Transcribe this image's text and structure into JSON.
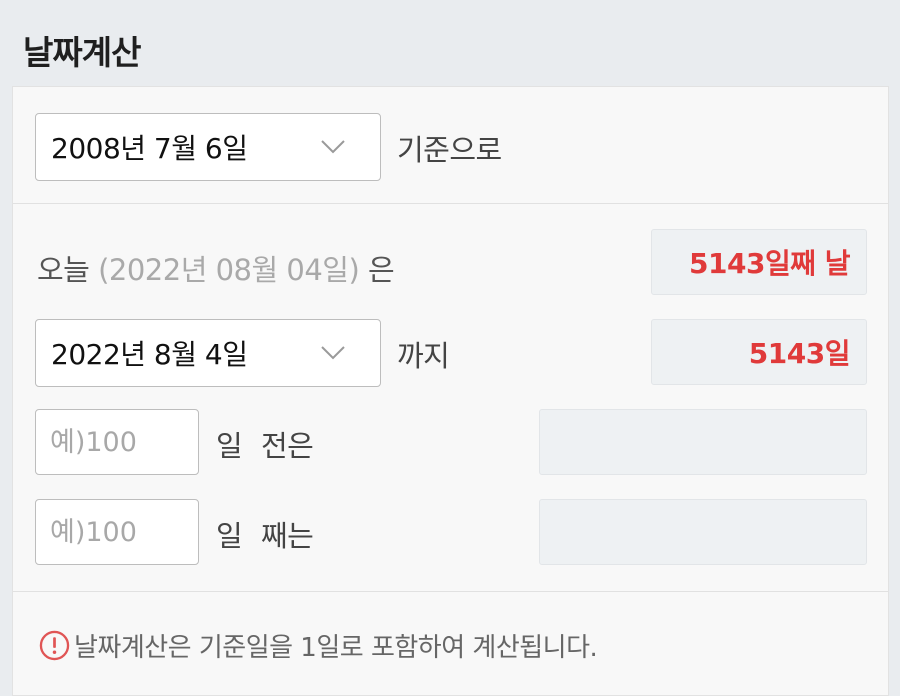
{
  "header": {
    "title": "날짜계산"
  },
  "base": {
    "date_select": "2008년 7월 6일",
    "suffix_label": "기준으로"
  },
  "today": {
    "prefix": "오늘",
    "date_text": "(2022년 08월 04일)",
    "suffix": "은",
    "result": "5143일째 날"
  },
  "until": {
    "date_select": "2022년 8월 4일",
    "label": "까지",
    "result": "5143일"
  },
  "days_before": {
    "placeholder": "예)100",
    "label_day": "일",
    "label_rest": "전은",
    "result": ""
  },
  "days_nth": {
    "placeholder": "예)100",
    "label_day": "일",
    "label_rest": "째는",
    "result": ""
  },
  "footer_note": {
    "text": "날짜계산은 기준일을 1일로 포함하여 계산됩니다."
  },
  "colors": {
    "accent_red": "#e03a3a",
    "alert_icon": "#e05555"
  }
}
